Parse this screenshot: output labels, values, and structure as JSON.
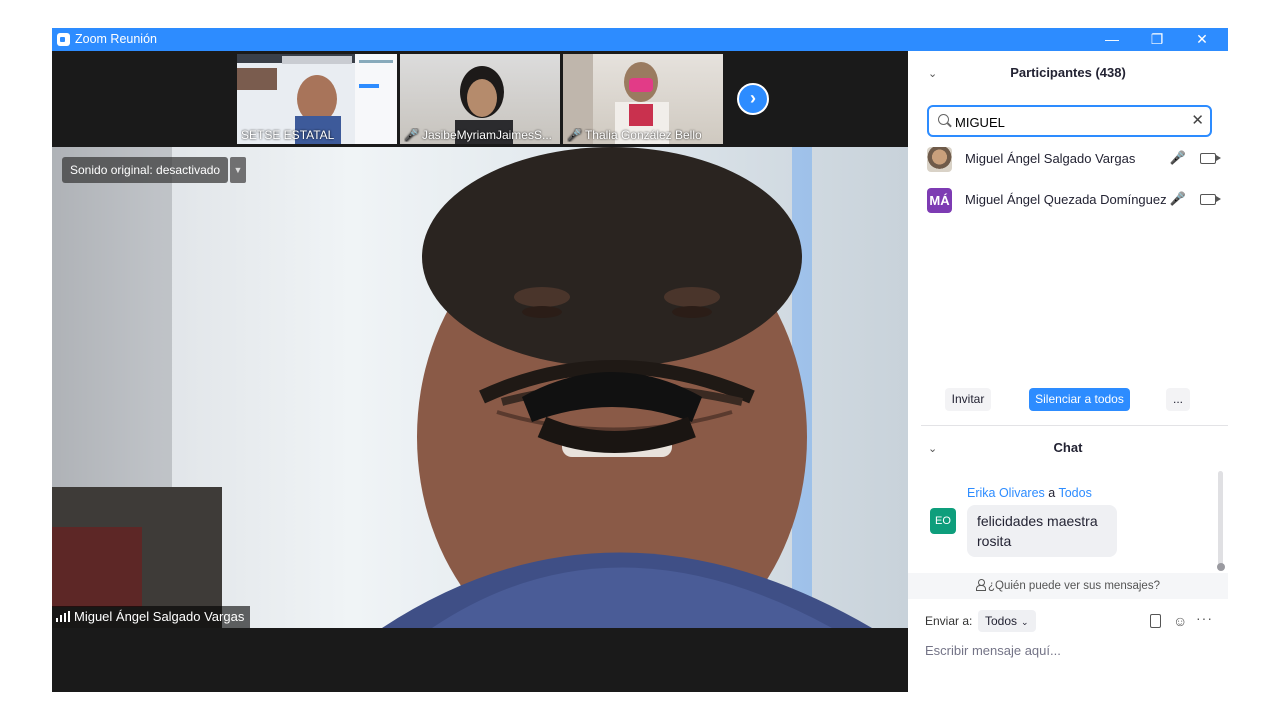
{
  "window": {
    "title": "Zoom Reunión",
    "minimize": "—",
    "restore": "❐",
    "close": "✕"
  },
  "thumbnails": [
    {
      "name": "SETSE ESTATAL",
      "muted": false
    },
    {
      "name": "JasibeMyriamJaimesS...",
      "muted": true
    },
    {
      "name": "Thalia González Bello",
      "muted": true
    }
  ],
  "next_arrow": "›",
  "main_video": {
    "sound_label": "Sonido original: desactivado",
    "sound_dropdown": "▼",
    "speaker": "Miguel Ángel Salgado Vargas"
  },
  "participants": {
    "title": "Participantes (438)",
    "collapse": "⌄",
    "search_value": "MIGUEL",
    "clear": "✕",
    "list": [
      {
        "name": "Miguel Ángel Salgado Vargas",
        "avatar": "photo",
        "mic": "🎤"
      },
      {
        "name": "Miguel Ángel Quezada Domínguez",
        "avatar": "MÁ",
        "mic": "🎤"
      }
    ],
    "invite": "Invitar",
    "mute_all": "Silenciar a todos",
    "more": "..."
  },
  "chat": {
    "title": "Chat",
    "collapse": "⌄",
    "message": {
      "sender": "Erika Olivares",
      "connector": "a",
      "recipient": "Todos",
      "initials": "EO",
      "text": "felicidades maestra rosita"
    },
    "visibility_notice": "¿Quién puede ver sus mensajes?",
    "send_to_label": "Enviar a:",
    "send_to_value": "Todos",
    "more": "···",
    "placeholder": "Escribir mensaje aquí..."
  },
  "colors": {
    "accent": "#2d8cff",
    "muted_red": "#e02828",
    "avatar_purple": "#7d3bb3",
    "avatar_green": "#0e9e7c"
  }
}
